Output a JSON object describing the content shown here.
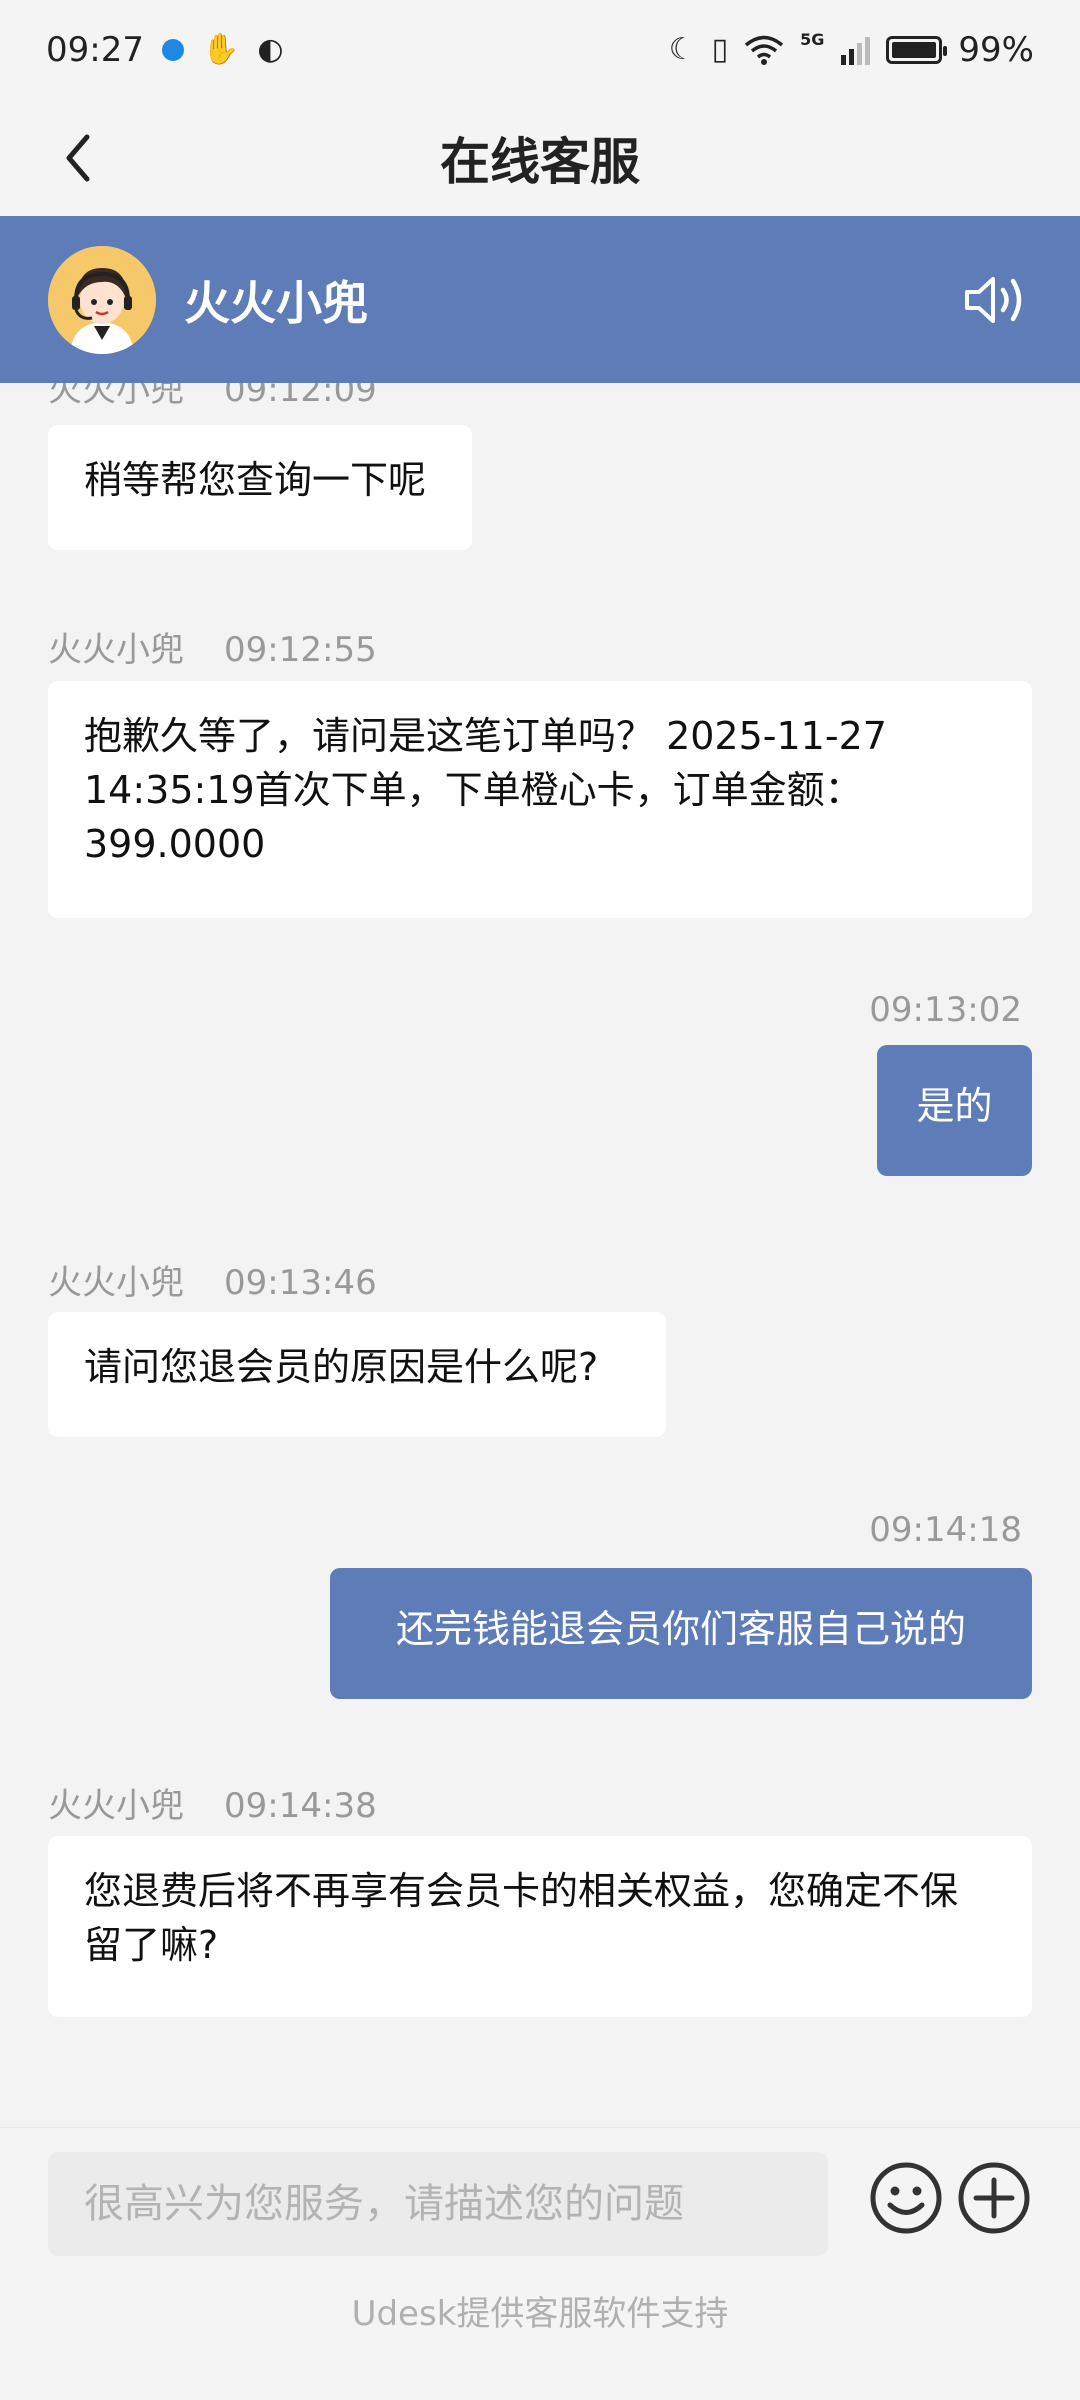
{
  "status_bar": {
    "time": "09:27",
    "network": "5G",
    "battery": "99%",
    "battery_level": 0.99
  },
  "nav": {
    "title": "在线客服"
  },
  "agent": {
    "name": "火火小兜"
  },
  "messages": [
    {
      "sender": "火火小兜",
      "time": "09:12:09",
      "text": "稍等帮您查询一下呢",
      "mine": false
    },
    {
      "sender": "火火小兜",
      "time": "09:12:55",
      "text_lines": [
        "抱歉久等了，请问是这笔订单吗？ 2025-11-27",
        "14:35:19首次下单，下单橙心卡，订单金额：",
        "399.0000"
      ],
      "mine": false
    },
    {
      "sender": "",
      "time": "09:13:02",
      "text": "是的",
      "mine": true
    },
    {
      "sender": "火火小兜",
      "time": "09:13:46",
      "text": "请问您退会员的原因是什么呢?",
      "mine": false
    },
    {
      "sender": "",
      "time": "09:14:18",
      "text": "还完钱能退会员你们客服自己说的",
      "mine": true
    },
    {
      "sender": "火火小兜",
      "time": "09:14:38",
      "text_lines": [
        "您退费后将不再享有会员卡的相关权益，您确定不保",
        "留了嘛?"
      ],
      "mine": false
    }
  ],
  "input": {
    "placeholder": "很高兴为您服务，请描述您的问题"
  },
  "footer": {
    "powered_by": "Udesk提供客服软件支持"
  },
  "icons": {
    "back": "chevron-left-icon",
    "speaker": "speaker-icon",
    "emoji": "smiley-icon",
    "plus": "plus-circle-icon"
  },
  "colors": {
    "accent": "#5d7cb8",
    "background": "#f3f3f3",
    "bubble_other": "#ffffff",
    "meta_text": "#999999"
  }
}
